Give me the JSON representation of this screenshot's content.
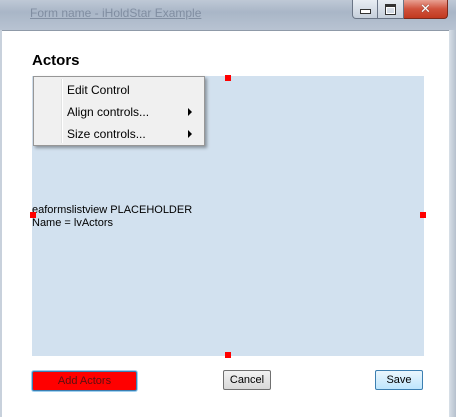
{
  "window": {
    "title": "Form name - iHoldStar Example",
    "buttons": {
      "minimize_icon": "minimize-icon",
      "maximize_icon": "maximize-icon",
      "close_icon": "close-icon",
      "close_glyph": "✕"
    }
  },
  "dialog": {
    "title": "Actors"
  },
  "designer": {
    "background_color": "#d2e1ef",
    "handle_color": "#ff0000",
    "placeholder_line1": "eaformslistview PLACEHOLDER",
    "placeholder_line2": "Name = lvActors"
  },
  "context_menu": {
    "items": [
      {
        "label": "Edit Control",
        "submenu": false
      },
      {
        "label": "Align controls...",
        "submenu": true
      },
      {
        "label": "Size controls...",
        "submenu": true
      }
    ]
  },
  "buttons": {
    "add_actors": "Add Actors",
    "cancel": "Cancel",
    "save": "Save"
  },
  "colors": {
    "add_button": "#ff0000",
    "save_button_hover": "#bee6fd"
  }
}
